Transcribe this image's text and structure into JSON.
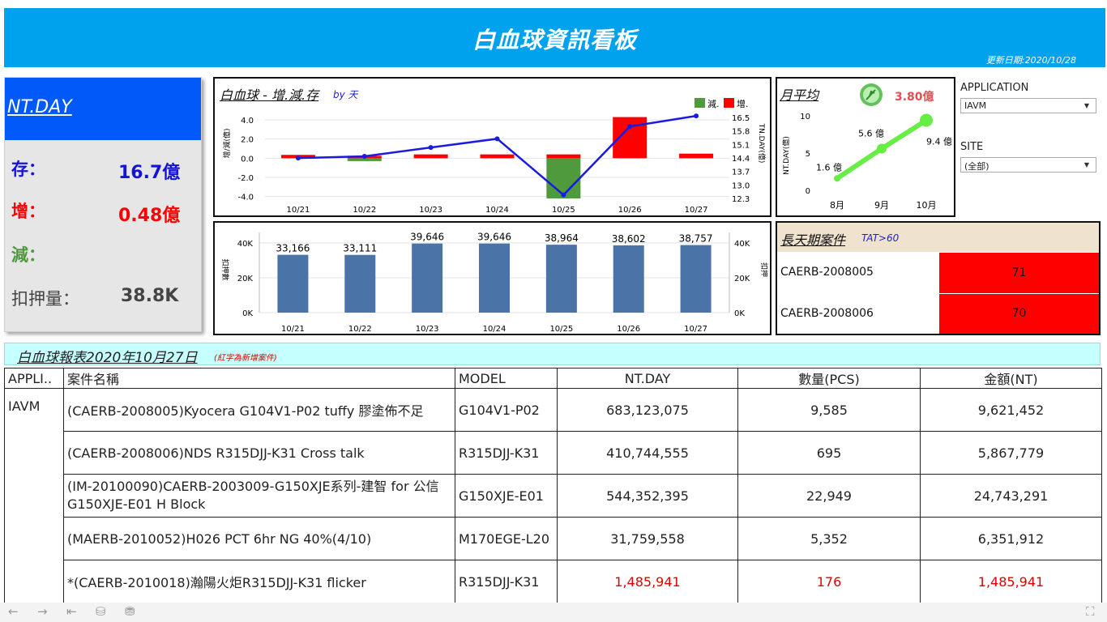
{
  "header": {
    "title": "白血球資訊看板",
    "update": "更新日期:2020/10/28"
  },
  "kpi": {
    "title": "NT.DAY",
    "rows": [
      {
        "label": "存：",
        "value": "16.7億",
        "color": "#1414d8"
      },
      {
        "label": "增：",
        "value": "0.48億",
        "color": "#ff0000"
      },
      {
        "label": "減：",
        "value": "",
        "color": "#4e9a3c"
      },
      {
        "label": "扣押量：",
        "value": "38.8K",
        "color": "#444444"
      }
    ]
  },
  "chart_top": {
    "title": "白血球 - 增.減.存",
    "subtitle": "by 天",
    "legend": [
      "減.",
      "增."
    ],
    "left_ticks": [
      "4.0",
      "2.0",
      "0.0",
      "-2.0",
      "-4.0"
    ],
    "right_ticks": [
      "16.5",
      "15.8",
      "15.1",
      "14.4",
      "13.7",
      "13.0",
      "12.3"
    ],
    "left_axis_label": "增/減(億)",
    "right_axis_label": "TN.DAY(億)"
  },
  "chart_bottom": {
    "left_ticks": [
      "40K",
      "20K",
      "0K"
    ],
    "right_ticks": [
      "40K",
      "20K",
      "0K"
    ],
    "left_axis_label": "扣押數",
    "right_axis_label": "扣押"
  },
  "monthly": {
    "title": "月平均",
    "avg_label": "3.80億",
    "y_ticks": [
      "10",
      "5",
      "0"
    ],
    "y_axis_label": "NT.DAY(億)"
  },
  "filters": {
    "application_label": "APPLICATION",
    "application_value": "IAVM",
    "site_label": "SITE",
    "site_value": "(全部)"
  },
  "long_days": {
    "title": "長天期案件",
    "subtitle": "TAT>60",
    "rows": [
      {
        "name": "CAERB-2008005",
        "days": "71"
      },
      {
        "name": "CAERB-2008006",
        "days": "70"
      }
    ]
  },
  "report": {
    "title": "白血球報表2020年10月27日",
    "note": "(紅字為新增案件)",
    "columns": [
      "APPLI..",
      "案件名稱",
      "MODEL",
      "NT.DAY",
      "數量(PCS)",
      "金額(NT)"
    ],
    "application": "IAVM",
    "rows": [
      {
        "case": "(CAERB-2008005)Kyocera G104V1-P02 tuffy 膠塗佈不足",
        "model": "G104V1-P02",
        "ntday": "683,123,075",
        "qty": "9,585",
        "amount": "9,621,452",
        "is_new": false
      },
      {
        "case": "(CAERB-2008006)NDS R315DJJ-K31 Cross talk",
        "model": "R315DJJ-K31",
        "ntday": "410,744,555",
        "qty": "695",
        "amount": "5,867,779",
        "is_new": false
      },
      {
        "case": "(IM-20100090)CAERB-2003009-G150XJE系列-建智 for 公信 G150XJE-E01 H Block",
        "model": "G150XJE-E01",
        "ntday": "544,352,395",
        "qty": "22,949",
        "amount": "24,743,291",
        "is_new": false
      },
      {
        "case": "(MAERB-2010052)H026 PCT 6hr NG 40%(4/10)",
        "model": "M170EGE-L20",
        "ntday": "31,759,558",
        "qty": "5,352",
        "amount": "6,351,912",
        "is_new": false
      },
      {
        "case": "*(CAERB-2010018)瀚陽火炬R315DJJ-K31 flicker",
        "model": "R315DJJ-K31",
        "ntday": "1,485,941",
        "qty": "176",
        "amount": "1,485,941",
        "is_new": true
      }
    ]
  },
  "colors": {
    "header": "#00a2ed",
    "kpi_head": "#0059f8",
    "increase": "#ff0000",
    "decrease": "#4e9a3c",
    "line": "#1a1ae0",
    "bar": "#4a73a8",
    "monthly_line": "#66ee44",
    "report_head": "#c5fffe"
  },
  "chart_data": [
    {
      "type": "bar",
      "name": "increase-decrease-stock",
      "categories": [
        "10/21",
        "10/22",
        "10/23",
        "10/24",
        "10/25",
        "10/26",
        "10/27"
      ],
      "series": [
        {
          "name": "增.",
          "values": [
            0.35,
            0.25,
            0.4,
            0.4,
            0.4,
            4.3,
            0.48
          ]
        },
        {
          "name": "減.",
          "values": [
            0,
            -0.3,
            0,
            0,
            -4.2,
            0,
            0
          ]
        }
      ],
      "line": {
        "values": [
          14.3,
          14.4,
          14.9,
          15.4,
          12.2,
          16.1,
          16.7
        ],
        "ylim": [
          12.0,
          16.8
        ]
      },
      "ylim": [
        -4.2,
        4.6
      ]
    },
    {
      "type": "bar",
      "name": "withheld",
      "categories": [
        "10/21",
        "10/22",
        "10/23",
        "10/24",
        "10/25",
        "10/26",
        "10/27"
      ],
      "values": [
        33166,
        33111,
        39646,
        39646,
        38964,
        38602,
        38757
      ],
      "labels": [
        "33,166",
        "33,111",
        "39,646",
        "39,646",
        "38,964",
        "38,602",
        "38,757"
      ],
      "ylim": [
        0,
        46000
      ]
    },
    {
      "type": "line",
      "name": "monthly-average",
      "categories": [
        "8月",
        "9月",
        "10月"
      ],
      "values": [
        1.6,
        5.6,
        9.4
      ],
      "labels": [
        "1.6 億",
        "5.6 億",
        "9.4 億"
      ],
      "ylim": [
        0,
        10
      ]
    }
  ]
}
